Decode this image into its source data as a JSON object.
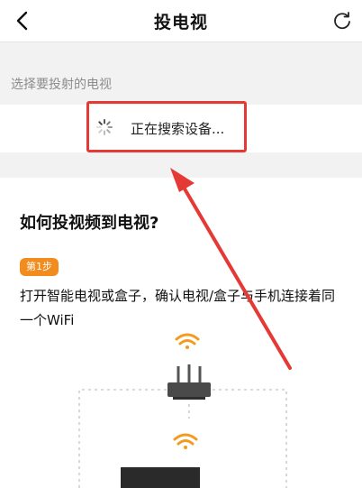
{
  "header": {
    "title": "投电视",
    "back_icon": "chevron-left-icon",
    "refresh_icon": "refresh-icon"
  },
  "device_section": {
    "label": "选择要投射的电视",
    "searching_text": "正在搜索设备..."
  },
  "help": {
    "title": "如何投视频到电视?",
    "step_badge": "第1步",
    "step_text": "打开智能电视或盒子，确认电视/盒子与手机连接着同一个WiFi"
  },
  "colors": {
    "annotation_red": "#e53935",
    "badge_orange": "#f28c1e",
    "wifi_orange": "#f39a1f"
  }
}
